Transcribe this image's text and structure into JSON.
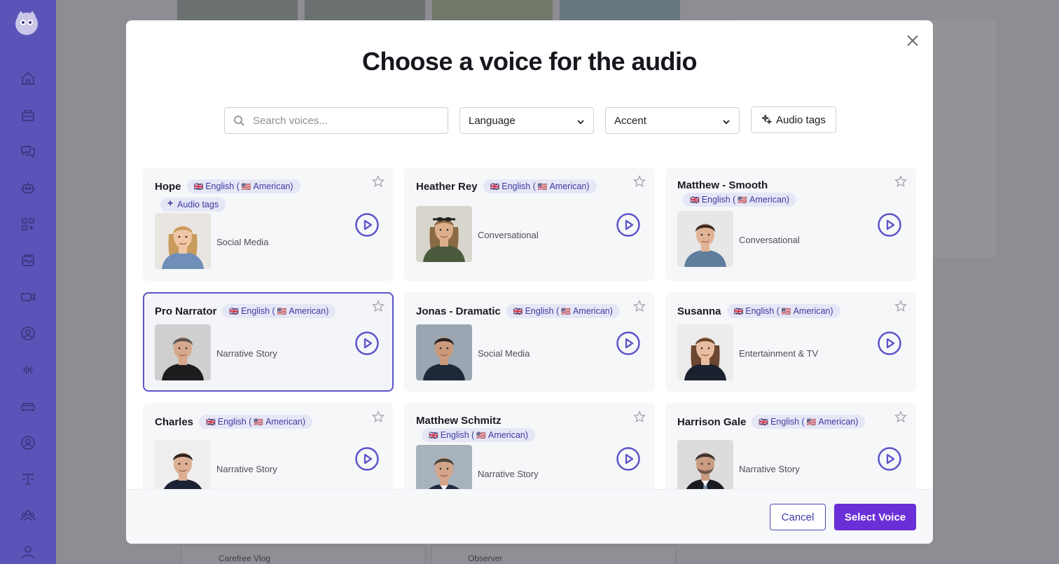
{
  "colors": {
    "accent": "#6a2fd6",
    "sidebar": "#5b54b8",
    "pill_bg": "#e6e7f6",
    "pill_text": "#3b3aa0"
  },
  "sidebar": {
    "items": [
      {
        "icon": "home-icon"
      },
      {
        "icon": "layers-icon"
      },
      {
        "icon": "chat-icon"
      },
      {
        "icon": "robot-icon"
      },
      {
        "icon": "apps-icon"
      },
      {
        "icon": "image-icon"
      },
      {
        "icon": "video-icon"
      },
      {
        "icon": "avatar-icon"
      },
      {
        "icon": "audio-wave-icon"
      },
      {
        "icon": "sofa-icon"
      },
      {
        "icon": "user-circle-icon"
      },
      {
        "icon": "text-tool-icon"
      },
      {
        "icon": "team-icon"
      },
      {
        "icon": "profile-icon"
      }
    ]
  },
  "background": {
    "bottom_cards": [
      "Carefree Vlog",
      "Observer"
    ]
  },
  "modal": {
    "title": "Choose a voice for the audio",
    "search": {
      "placeholder": "Search voices..."
    },
    "language_select": {
      "value": "Language"
    },
    "accent_select": {
      "value": "Accent"
    },
    "audio_tags_button": "Audio tags",
    "voices": [
      {
        "name": "Hope",
        "language": "English (",
        "accent": "American)",
        "tag": "Audio tags",
        "category": "Social Media",
        "photo": "woman-blonde"
      },
      {
        "name": "Heather Rey",
        "language": "English (",
        "accent": "American)",
        "category": "Conversational",
        "photo": "woman-sunglasses"
      },
      {
        "name": "Matthew - Smooth",
        "language": "English (",
        "accent": "American)",
        "category": "Conversational",
        "photo": "man-denim"
      },
      {
        "name": "Pro Narrator",
        "language": "English (",
        "accent": "American)",
        "category": "Narrative Story",
        "photo": "man-grey",
        "selected": true
      },
      {
        "name": "Jonas - Dramatic",
        "language": "English (",
        "accent": "American)",
        "category": "Social Media",
        "photo": "man-suit-dark"
      },
      {
        "name": "Susanna",
        "language": "English (",
        "accent": "American)",
        "category": "Entertainment & TV",
        "photo": "woman-suit"
      },
      {
        "name": "Charles",
        "language": "English (",
        "accent": "American)",
        "category": "Narrative Story",
        "photo": "man-young-suit"
      },
      {
        "name": "Matthew Schmitz",
        "language": "English (",
        "accent": "American)",
        "category": "Narrative Story",
        "photo": "man-tie"
      },
      {
        "name": "Harrison Gale",
        "language": "English (",
        "accent": "American)",
        "category": "Narrative Story",
        "photo": "man-beard-suit"
      }
    ],
    "footer": {
      "cancel_label": "Cancel",
      "select_label": "Select Voice"
    }
  }
}
